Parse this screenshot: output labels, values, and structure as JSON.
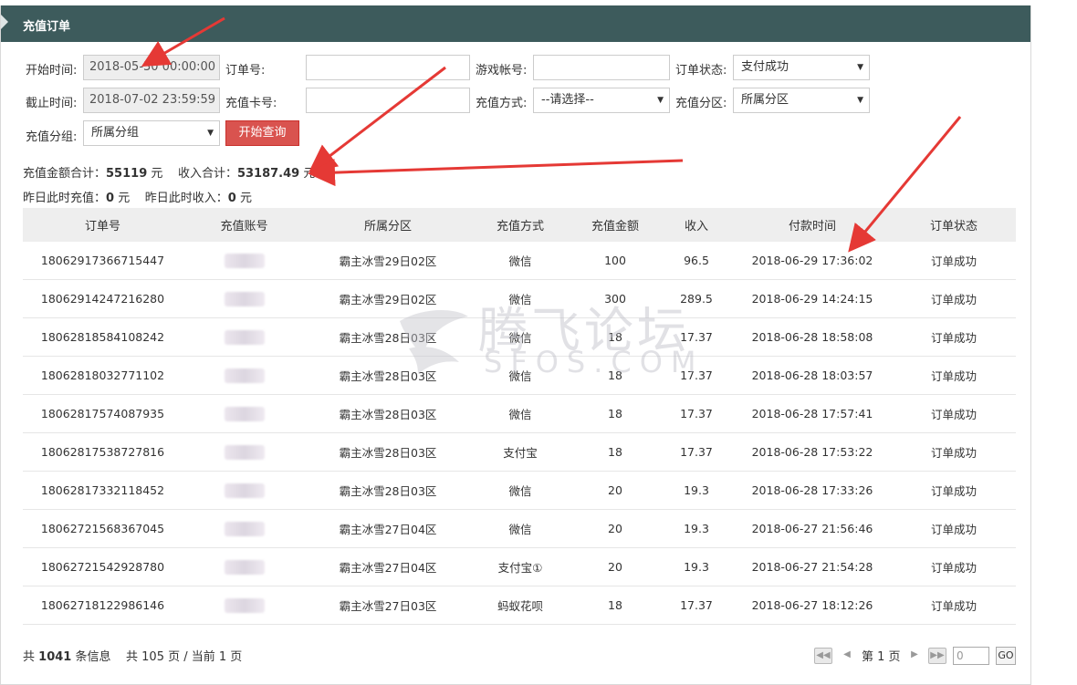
{
  "panel": {
    "title": "充值订单"
  },
  "filters": {
    "start_time_label": "开始时间:",
    "start_time_value": "2018-05-30 00:00:00",
    "end_time_label": "截止时间:",
    "end_time_value": "2018-07-02 23:59:59",
    "order_no_label": "订单号:",
    "order_no_value": "",
    "card_no_label": "充值卡号:",
    "card_no_value": "",
    "game_account_label": "游戏帐号:",
    "game_account_value": "",
    "pay_method_label": "充值方式:",
    "pay_method_value": "--请选择--",
    "order_status_label": "订单状态:",
    "order_status_value": "支付成功",
    "zone_label": "充值分区:",
    "zone_value": "所属分区",
    "group_label": "充值分组:",
    "group_value": "所属分组",
    "query_button": "开始查询"
  },
  "summary": {
    "total_recharge_label": "充值金额合计：",
    "total_recharge_value": "55119",
    "total_recharge_unit": "元",
    "total_income_label": "收入合计：",
    "total_income_value": "53187.49",
    "total_income_unit": "元",
    "yesterday_recharge_label": "昨日此时充值：",
    "yesterday_recharge_value": "0",
    "yesterday_recharge_unit": "元",
    "yesterday_income_label": "昨日此时收入：",
    "yesterday_income_value": "0",
    "yesterday_income_unit": "元"
  },
  "table": {
    "headers": [
      "订单号",
      "充值账号",
      "所属分区",
      "充值方式",
      "充值金额",
      "收入",
      "付款时间",
      "订单状态"
    ],
    "rows": [
      {
        "order_no": "18062917366715447",
        "zone": "霸主冰雪29日02区",
        "method": "微信",
        "amount": "100",
        "income": "96.5",
        "paid_at": "2018-06-29 17:36:02",
        "status": "订单成功"
      },
      {
        "order_no": "18062914247216280",
        "zone": "霸主冰雪29日02区",
        "method": "微信",
        "amount": "300",
        "income": "289.5",
        "paid_at": "2018-06-29 14:24:15",
        "status": "订单成功"
      },
      {
        "order_no": "18062818584108242",
        "zone": "霸主冰雪28日03区",
        "method": "微信",
        "amount": "18",
        "income": "17.37",
        "paid_at": "2018-06-28 18:58:08",
        "status": "订单成功"
      },
      {
        "order_no": "18062818032771102",
        "zone": "霸主冰雪28日03区",
        "method": "微信",
        "amount": "18",
        "income": "17.37",
        "paid_at": "2018-06-28 18:03:57",
        "status": "订单成功"
      },
      {
        "order_no": "18062817574087935",
        "zone": "霸主冰雪28日03区",
        "method": "微信",
        "amount": "18",
        "income": "17.37",
        "paid_at": "2018-06-28 17:57:41",
        "status": "订单成功"
      },
      {
        "order_no": "18062817538727816",
        "zone": "霸主冰雪28日03区",
        "method": "支付宝",
        "amount": "18",
        "income": "17.37",
        "paid_at": "2018-06-28 17:53:22",
        "status": "订单成功"
      },
      {
        "order_no": "18062817332118452",
        "zone": "霸主冰雪28日03区",
        "method": "微信",
        "amount": "20",
        "income": "19.3",
        "paid_at": "2018-06-28 17:33:26",
        "status": "订单成功"
      },
      {
        "order_no": "18062721568367045",
        "zone": "霸主冰雪27日04区",
        "method": "微信",
        "amount": "20",
        "income": "19.3",
        "paid_at": "2018-06-27 21:56:46",
        "status": "订单成功"
      },
      {
        "order_no": "18062721542928780",
        "zone": "霸主冰雪27日04区",
        "method": "支付宝①",
        "amount": "20",
        "income": "19.3",
        "paid_at": "2018-06-27 21:54:28",
        "status": "订单成功"
      },
      {
        "order_no": "18062718122986146",
        "zone": "霸主冰雪27日03区",
        "method": "蚂蚁花呗",
        "amount": "18",
        "income": "17.37",
        "paid_at": "2018-06-27 18:12:26",
        "status": "订单成功"
      }
    ]
  },
  "pagination": {
    "total_prefix": "共",
    "total_count": "1041",
    "total_suffix": "条信息",
    "pages_text": "共 105 页 / 当前 1 页",
    "current_page_text": "第 1 页",
    "goto_value": "0",
    "go_label": "GO"
  },
  "watermark": {
    "cn": "腾飞论坛",
    "en": "SFOS.COM"
  },
  "colors": {
    "header_bg": "#3d5b5c",
    "query_button": "#d9534f",
    "status_success": "#1a8a1a",
    "annotation_arrow": "#e53935"
  }
}
